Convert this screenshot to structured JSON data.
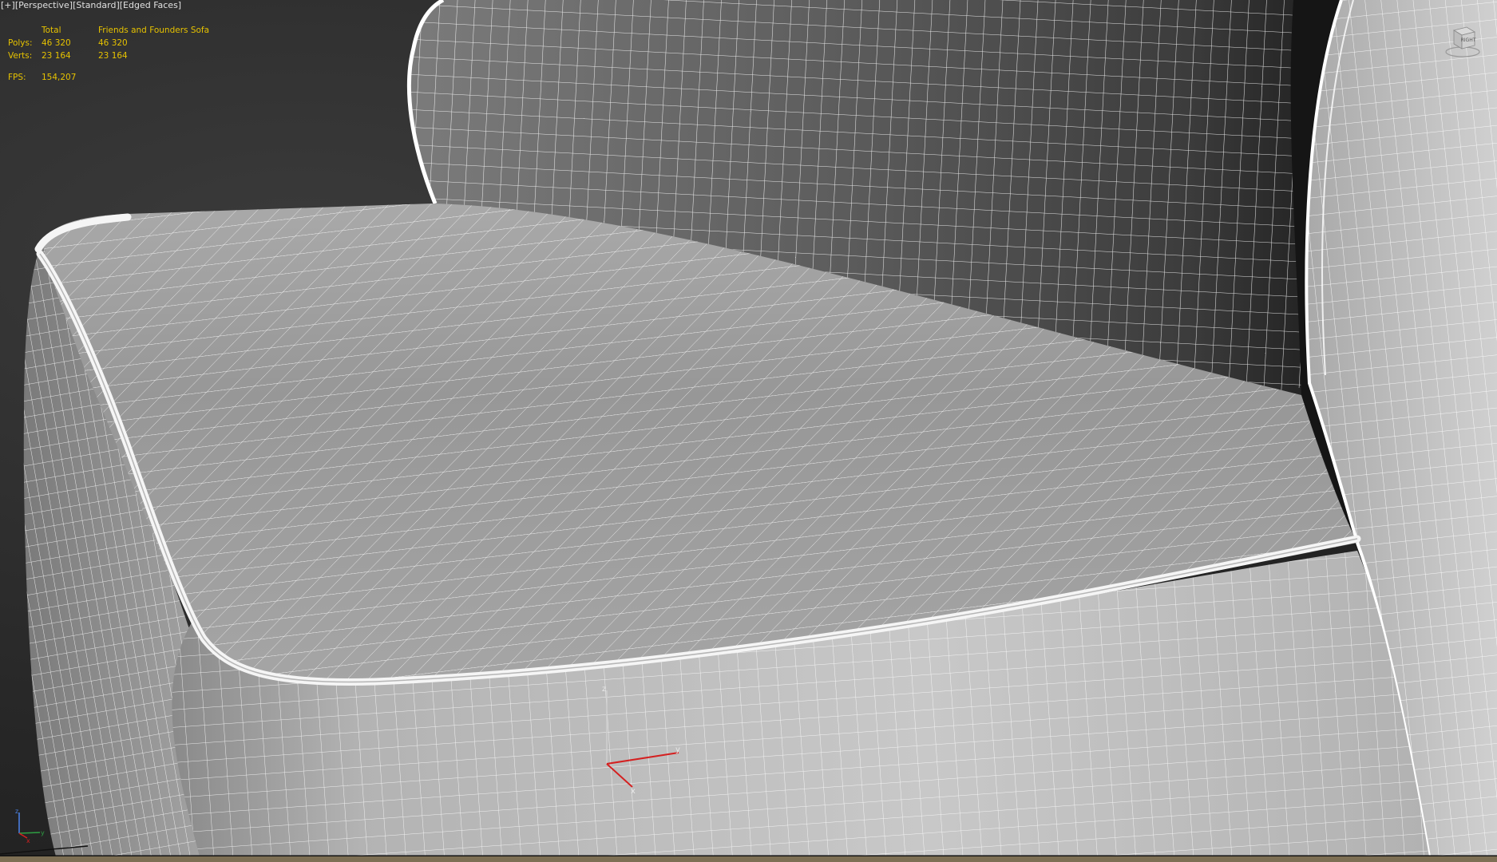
{
  "viewport": {
    "labels": [
      "[+]",
      "[Perspective]",
      "[Standard]",
      "[Edged Faces]"
    ]
  },
  "stats": {
    "header_total": "Total",
    "header_object": "Friends and Founders Sofa",
    "polys_label": "Polys:",
    "polys_total": "46 320",
    "polys_object": "46 320",
    "verts_label": "Verts:",
    "verts_total": "23 164",
    "verts_object": "23 164",
    "fps_label": "FPS:",
    "fps_value": "154,207"
  },
  "viewcube": {
    "face_label": "RIGHT",
    "icon": "viewcube-icon"
  },
  "gizmo": {
    "x_label": "x",
    "y_label": "y",
    "z_label": "z"
  },
  "world_axis": {
    "x_label": "x",
    "y_label": "y",
    "z_label": "z"
  },
  "colors": {
    "stats_text": "#e6c200",
    "wire": "#ffffff",
    "surface_light": "#c4c4c4",
    "surface_dark": "#4d4d4d",
    "axis_x": "#d42020",
    "axis_y": "#d42020",
    "axis_z": "#cfcfcf"
  }
}
